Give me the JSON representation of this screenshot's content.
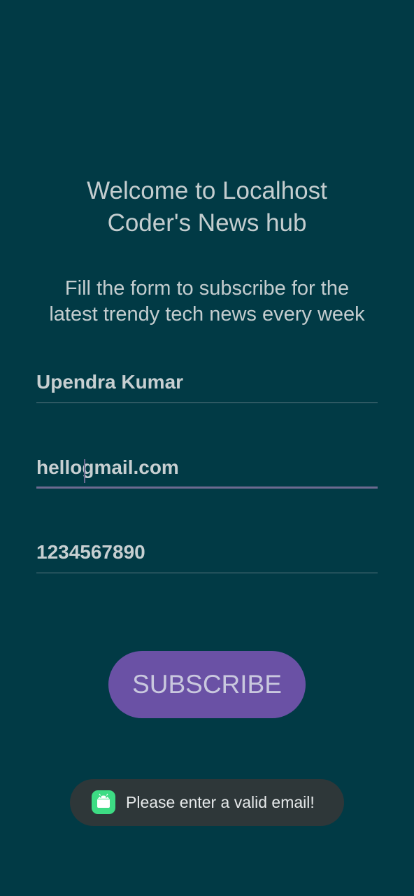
{
  "header": {
    "title_line1": "Welcome to Localhost",
    "title_line2": "Coder's News hub",
    "subtitle_line1": "Fill the form to subscribe for the",
    "subtitle_line2": "latest trendy tech news every week"
  },
  "form": {
    "name_value": "Upendra Kumar",
    "email_value": "hellogmail.com",
    "phone_value": "1234567890",
    "subscribe_label": "SUBSCRIBE"
  },
  "toast": {
    "message": "Please enter a valid email!",
    "icon": "android-app-icon"
  },
  "colors": {
    "background": "#013A45",
    "accent_button": "#6A51A5",
    "text": "#C4CDCF",
    "toast_background": "#2E3739",
    "android_icon": "#3DDC84"
  }
}
